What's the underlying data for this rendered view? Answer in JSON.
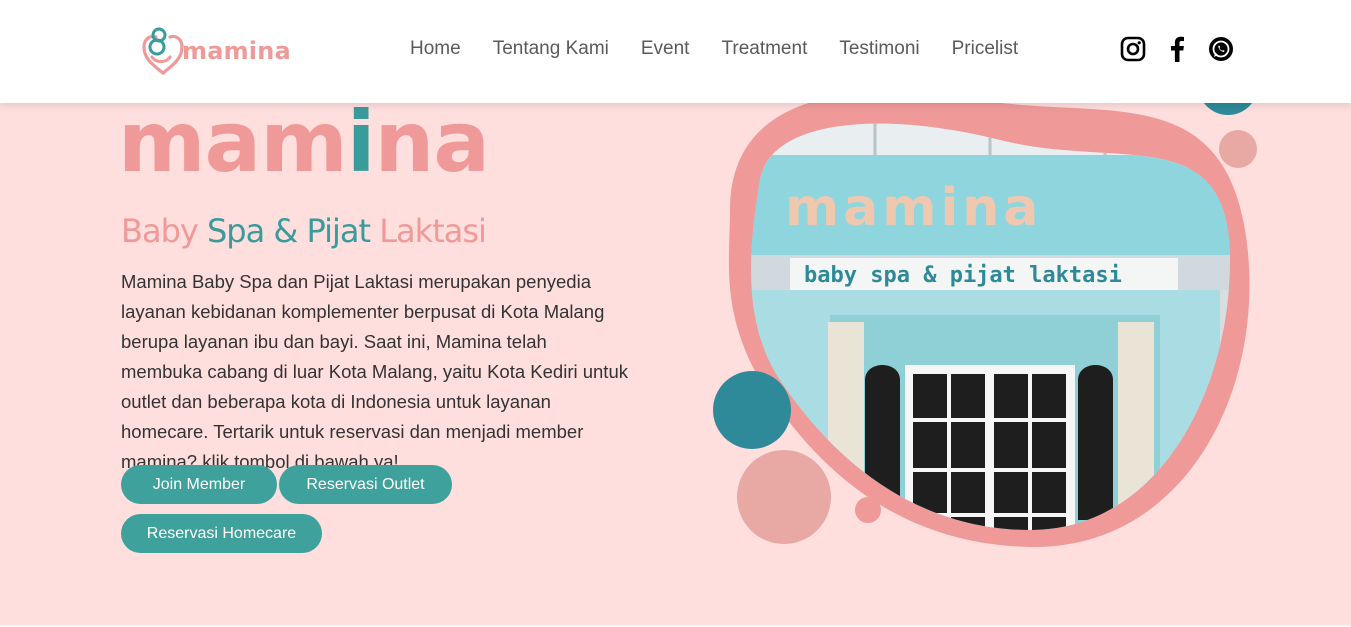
{
  "header": {
    "logo_text": "mamina",
    "nav": [
      "Home",
      "Tentang Kami",
      "Event",
      "Treatment",
      "Testimoni",
      "Pricelist"
    ],
    "social": [
      "instagram-icon",
      "facebook-icon",
      "whatsapp-icon"
    ]
  },
  "hero": {
    "title_part1": "mam",
    "title_accent": "i",
    "title_part2": "na",
    "subtitle_1": "Baby ",
    "subtitle_2": "Spa & Pijat",
    "subtitle_3": " Laktasi",
    "description": "Mamina Baby Spa dan Pijat Laktasi merupakan penyedia layanan kebidanan komplementer berpusat di Kota Malang berupa layanan ibu dan bayi. Saat ini, Mamina telah membuka cabang di luar Kota Malang, yaitu Kota Kediri untuk outlet dan beberapa kota di Indonesia untuk layanan homecare. Tertarik untuk reservasi dan menjadi member mamina? klik tombol di bawah ya!",
    "buttons": {
      "join": "Join Member",
      "outlet": "Reservasi Outlet",
      "homecare": "Reservasi Homecare"
    }
  },
  "storefront": {
    "sign_name": "mamina",
    "sign_sub": "baby spa & pijat laktasi"
  },
  "colors": {
    "pink": "#ef9a98",
    "teal": "#3a9b9b",
    "background": "#ffdede"
  }
}
